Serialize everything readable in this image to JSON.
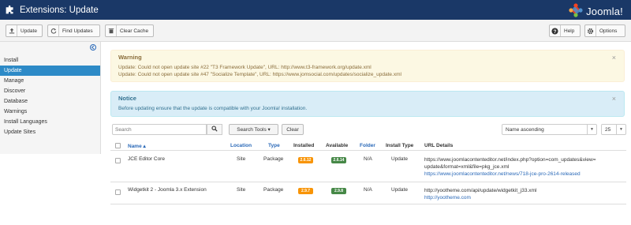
{
  "header": {
    "title": "Extensions: Update",
    "brand": "Joomla!",
    "icons": {
      "title_icon": "puzzle-icon",
      "brand_icon": "joomla-logo"
    },
    "colors": {
      "bar": "#1a3867"
    }
  },
  "toolbar": {
    "update_label": "Update",
    "find_updates_label": "Find Updates",
    "clear_cache_label": "Clear Cache",
    "help_label": "Help",
    "options_label": "Options"
  },
  "sidebar": {
    "items": [
      {
        "label": "Install"
      },
      {
        "label": "Update",
        "active": true
      },
      {
        "label": "Manage"
      },
      {
        "label": "Discover"
      },
      {
        "label": "Database"
      },
      {
        "label": "Warnings"
      },
      {
        "label": "Install Languages"
      },
      {
        "label": "Update Sites"
      }
    ],
    "active_color": "#2d8ac7"
  },
  "alerts": {
    "warning": {
      "heading": "Warning",
      "lines": [
        "Update: Could not open update site #22 \"T3 Framework Update\", URL: http://www.t3-framework.org/update.xml",
        "Update: Could not open update site #47 \"Socialize Template\", URL: https://www.jomsocial.com/updates/socialize_update.xml"
      ],
      "close": "×"
    },
    "notice": {
      "heading": "Notice",
      "lines": [
        "Before updating ensure that the update is compatible with your Joomla! installation."
      ],
      "close": "×"
    }
  },
  "filters": {
    "search_placeholder": "Search",
    "search_tools_label": "Search Tools ▾",
    "clear_label": "Clear",
    "ordering_value": "Name ascending",
    "limit_value": "25"
  },
  "table": {
    "headers": {
      "name": "Name ▴",
      "location": "Location",
      "type": "Type",
      "installed": "Installed",
      "available": "Available",
      "folder": "Folder",
      "install_type": "Install Type",
      "url": "URL Details"
    },
    "rows": [
      {
        "name": "JCE Editor Core",
        "location": "Site",
        "type": "Package",
        "installed": "2.6.12",
        "available": "2.6.14",
        "folder": "N/A",
        "install_type": "Update",
        "url_lines": [
          "https://www.joomlacontenteditor.net/index.php?option=com_updates&view=",
          "update&format=xml&file=pkg_jce.xml"
        ],
        "info_url": "https://www.joomlacontenteditor.net/news/718-jce-pro-2614-released"
      },
      {
        "name": "Widgetkit 2 - Joomla 3.x Extension",
        "location": "Site",
        "type": "Package",
        "installed": "2.9.7",
        "available": "2.9.8",
        "folder": "N/A",
        "install_type": "Update",
        "url_lines": [
          "http://yootheme.com/api/update/widgetkit_j33.xml"
        ],
        "info_url": "http://yootheme.com"
      }
    ]
  }
}
